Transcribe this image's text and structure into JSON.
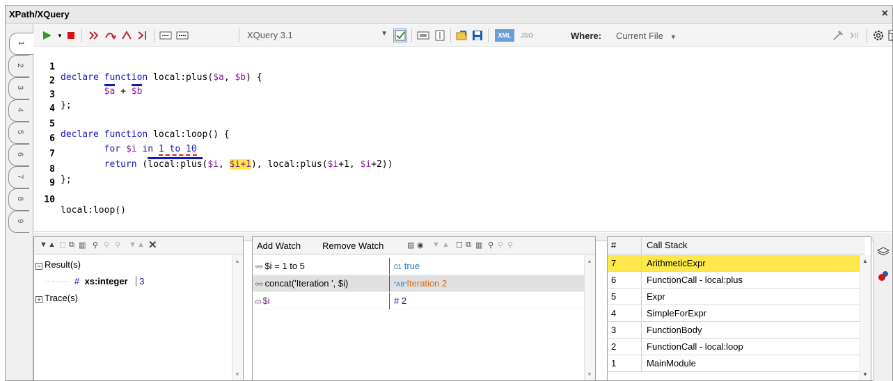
{
  "window": {
    "title": "XPath/XQuery",
    "close_glyph": "×"
  },
  "tabs": [
    "1",
    "2",
    "3",
    "4",
    "5",
    "6",
    "7",
    "8",
    "9"
  ],
  "toolbar": {
    "language": "XQuery 3.1",
    "xml_label": "XML",
    "json_label": "JSO",
    "where_label": "Where:",
    "where_value": "Current File"
  },
  "editor": {
    "line_numbers": [
      "1",
      "2",
      "3",
      "4",
      "5",
      "6",
      "7",
      "8",
      "9",
      "10"
    ]
  },
  "code": {
    "l1": {
      "kw": "declare function",
      "name": " local:plus(",
      "a": "$a",
      "c": ", ",
      "b": "$b",
      "tail": ") {"
    },
    "l2": {
      "a": "$a",
      "op": " + ",
      "b": "$b"
    },
    "l3": "};",
    "l5": {
      "kw": "declare function",
      "tail": " local:loop() {"
    },
    "l6": {
      "for": "for",
      "i": "$i",
      "in": "in",
      "range": "1 to 10"
    },
    "l7": {
      "ret": "return",
      "open": " (",
      "call": "local:plus",
      "p1": "(",
      "i1": "$i",
      "c1": ", ",
      "i2": "$i+1",
      "p2": "), local:plus(",
      "i3": "$i",
      "c2": "+1, ",
      "i4": "$i",
      "tail": "+2))"
    },
    "l8": "};",
    "l10": "local:loop()"
  },
  "results_panel": {
    "result_label": "Result(s)",
    "item_type": "xs:integer",
    "item_value": "3",
    "trace_label": "Trace(s)"
  },
  "watch_panel": {
    "add_watch": "Add Watch",
    "remove_watch": "Remove Watch",
    "rows": [
      {
        "expr": "$i  = 1 to 5",
        "type_badge": "01",
        "value": "true"
      },
      {
        "expr": "concat('Iteration ', $i)",
        "type_badge": "\"AB\"",
        "value": "Iteration 2"
      },
      {
        "expr": "$i",
        "type_badge": "#",
        "value": "2"
      }
    ]
  },
  "callstack": {
    "num_header": "#",
    "name_header": "Call Stack",
    "rows": [
      {
        "num": "7",
        "name": "ArithmeticExpr"
      },
      {
        "num": "6",
        "name": "FunctionCall - local:plus"
      },
      {
        "num": "5",
        "name": "Expr"
      },
      {
        "num": "4",
        "name": "SimpleForExpr"
      },
      {
        "num": "3",
        "name": "FunctionBody"
      },
      {
        "num": "2",
        "name": "FunctionCall - local:loop"
      },
      {
        "num": "1",
        "name": "MainModule"
      }
    ]
  },
  "colors": {
    "keyword": "#1818b8",
    "variable": "#8a1d9a",
    "highlight": "#ffe94a",
    "error": "#d51a1a",
    "watch_value": "#1a7fbf",
    "watch_string": "#d06a10"
  }
}
